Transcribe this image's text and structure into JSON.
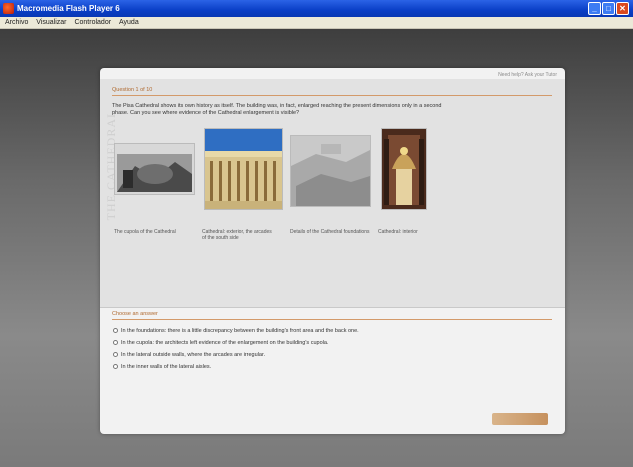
{
  "window": {
    "title": "Macromedia Flash Player 6",
    "buttons": {
      "minimize": "_",
      "maximize": "□",
      "close": "✕"
    }
  },
  "menu": [
    "Archivo",
    "Visualizar",
    "Controlador",
    "Ayuda"
  ],
  "panel": {
    "top_link": "Need help? Ask your Tutor",
    "vertical_title": "THE CATHEDRAL",
    "question_label": "Question 1 of 10",
    "question_text": "The Pisa Cathedral shows its own history as itself. The building was, in fact, enlarged reaching the present dimensions only in a second phase. Can you see where evidence of the Cathedral enlargement is visible?",
    "images": [
      {
        "caption": "The cupola of the Cathedral",
        "icon": "cupola-photo"
      },
      {
        "caption": "Cathedral: exterior, the arcades of the south side",
        "icon": "exterior-photo"
      },
      {
        "caption": "Details of the Cathedral foundations",
        "icon": "foundations-photo"
      },
      {
        "caption": "Cathedral: interior",
        "icon": "interior-photo"
      }
    ],
    "choose_label": "Choose an answer",
    "options": [
      "In the foundations: there is a little discrepancy between the building's front area and the back one.",
      "In the cupola: the architects left evidence of the enlargement on the building's cupola.",
      "In the lateral outside walls, where the arcades are irregular.",
      "In the inner walls of the lateral aisles."
    ],
    "submit_label": ""
  },
  "colors": {
    "accent": "#d39a6a",
    "titlebar": "#0a3fc7",
    "panel": "#f2f2f2"
  }
}
